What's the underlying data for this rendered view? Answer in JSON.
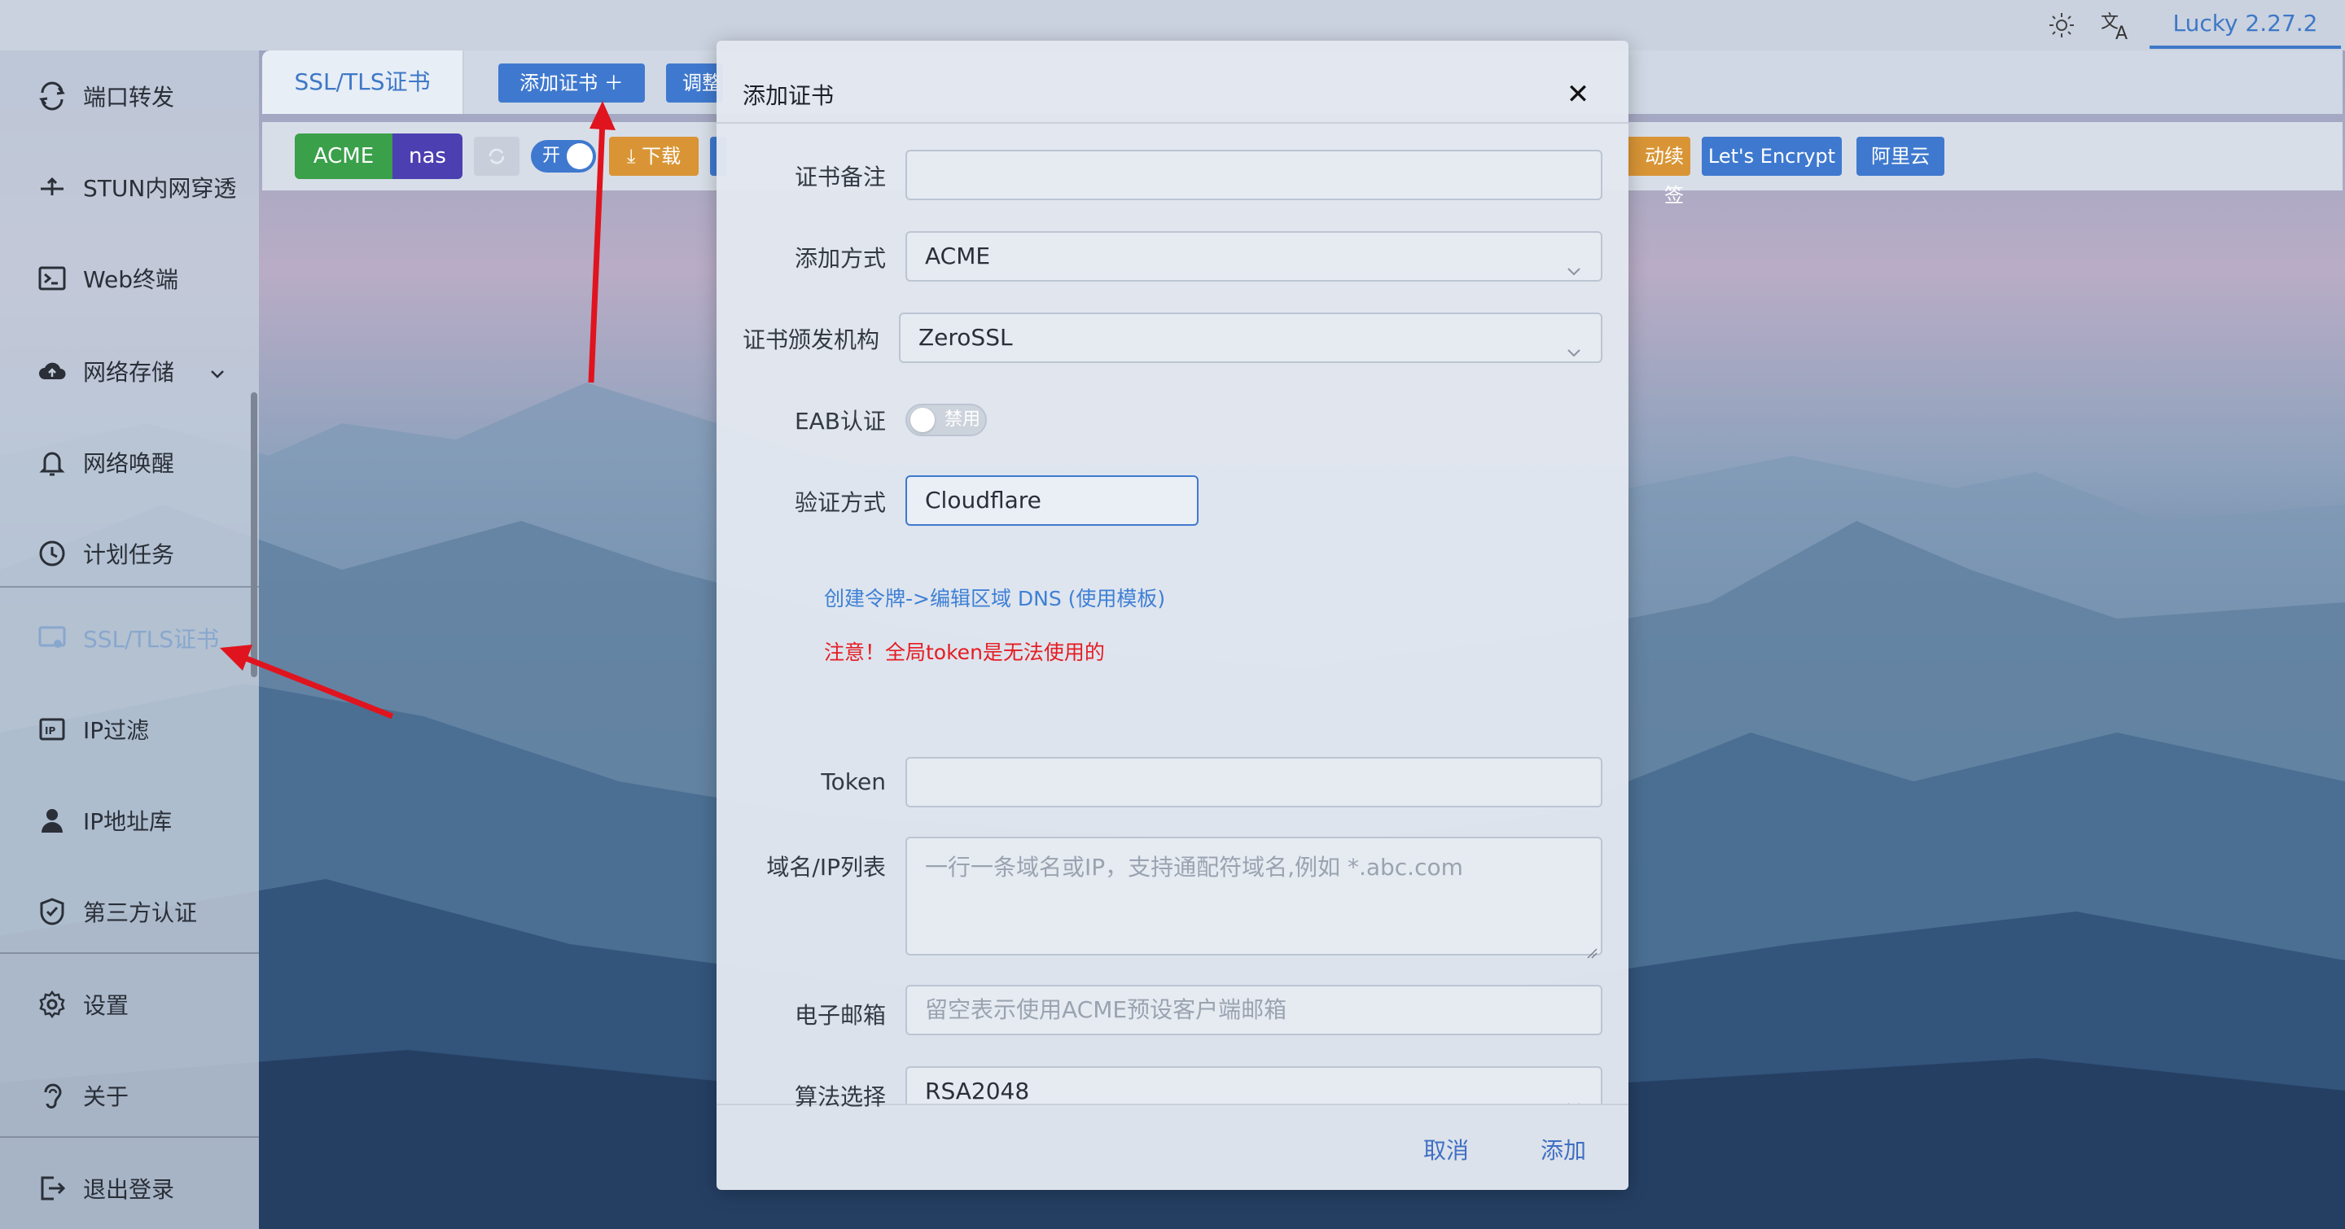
{
  "topbar": {
    "theme_icon": "sun-icon",
    "language_icon": "translate-icon",
    "version": "Lucky 2.27.2"
  },
  "sidebar": {
    "items": [
      {
        "label": "端口转发",
        "icon": "port-forward-icon"
      },
      {
        "label": "STUN内网穿透",
        "icon": "stun-icon"
      },
      {
        "label": "Web终端",
        "icon": "terminal-icon"
      },
      {
        "label": "网络存储",
        "icon": "cloud-storage-icon"
      },
      {
        "label": "网络唤醒",
        "icon": "bell-icon"
      },
      {
        "label": "计划任务",
        "icon": "clock-icon"
      },
      {
        "label": "SSL/TLS证书",
        "icon": "certificate-icon"
      },
      {
        "label": "IP过滤",
        "icon": "ip-filter-icon"
      },
      {
        "label": "IP地址库",
        "icon": "person-icon"
      },
      {
        "label": "第三方认证",
        "icon": "shield-icon"
      },
      {
        "label": "设置",
        "icon": "gear-icon"
      },
      {
        "label": "关于",
        "icon": "ear-icon"
      },
      {
        "label": "退出登录",
        "icon": "logout-icon"
      }
    ]
  },
  "main": {
    "tab_ssl": "SSL/TLS证书",
    "add_cert_button": "添加证书 ＋",
    "adjust_button": "调整",
    "toolbar": {
      "acme_tag": "ACME",
      "nas_tag": "nas",
      "toggle_on_label": "开",
      "download_button": "⤓ 下载",
      "renew_button": "动续签",
      "letsencrypt_button": "Let's Encrypt",
      "aliyun_button": "阿里云"
    }
  },
  "dialog": {
    "title": "添加证书",
    "close_icon": "close-icon",
    "fields": {
      "remark": {
        "label": "证书备注",
        "value": ""
      },
      "add_method": {
        "label": "添加方式",
        "value": "ACME"
      },
      "ca": {
        "label": "证书颁发机构",
        "value": "ZeroSSL"
      },
      "eab": {
        "label": "EAB认证",
        "toggle_label": "禁用"
      },
      "verify": {
        "label": "验证方式",
        "value": "Cloudflare"
      },
      "token": {
        "label": "Token",
        "value": ""
      },
      "domains": {
        "label": "域名/IP列表",
        "placeholder": "一行一条域名或IP，支持通配符域名,例如 *.abc.com"
      },
      "email": {
        "label": "电子邮箱",
        "placeholder": "留空表示使用ACME预设客户端邮箱"
      },
      "algorithm": {
        "label": "算法选择",
        "value": "RSA2048"
      }
    },
    "create_token_link": "创建令牌->编辑区域 DNS (使用模板)",
    "warning": "注意！全局token是无法使用的",
    "cancel_button": "取消",
    "add_button": "添加"
  },
  "colors": {
    "accent": "#3f79cf",
    "acme_green": "#3aa04a",
    "nas_purple": "#4c3fb1",
    "orange": "#d99535",
    "warning_red": "#e51c23",
    "arrow_red": "#e0141e"
  }
}
